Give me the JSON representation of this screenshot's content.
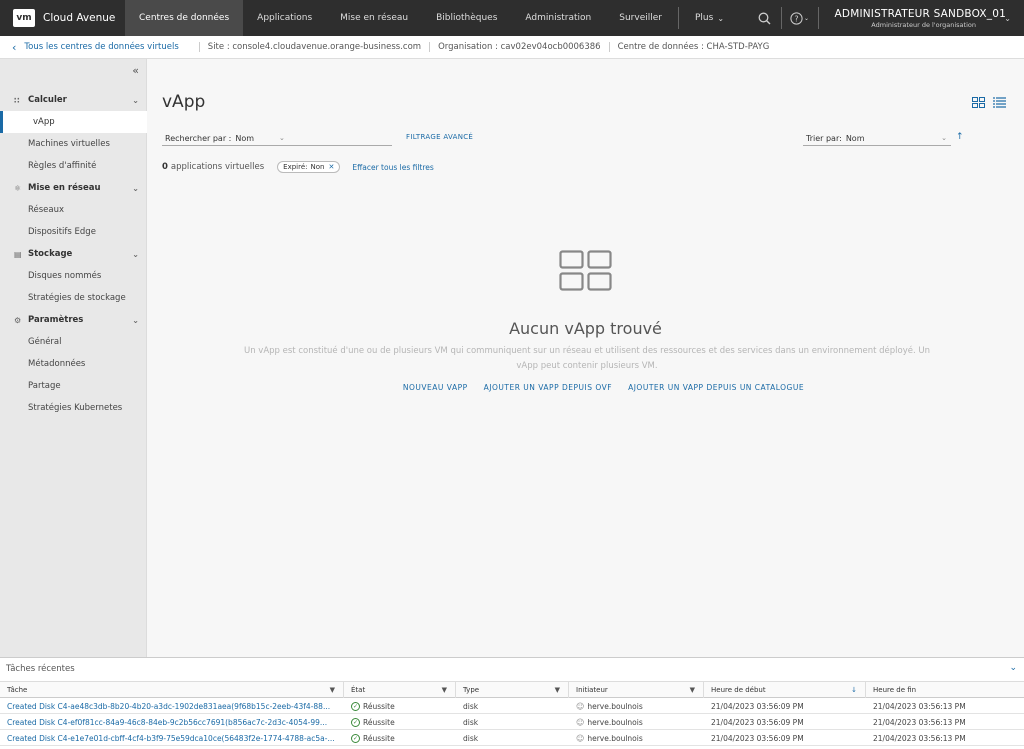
{
  "brand": {
    "logo": "vm",
    "name": "Cloud Avenue"
  },
  "topnav": {
    "items": [
      {
        "label": "Centres de données",
        "active": true
      },
      {
        "label": "Applications"
      },
      {
        "label": "Mise en réseau"
      },
      {
        "label": "Bibliothèques"
      },
      {
        "label": "Administration"
      },
      {
        "label": "Surveiller"
      }
    ],
    "more_label": "Plus",
    "user_name": "ADMINISTRATEUR SANDBOX_01",
    "user_role": "Administrateur de l'organisation"
  },
  "breadcrumb": {
    "back_label": "Tous les centres de données virtuels",
    "site": "Site : console4.cloudavenue.orange-business.com",
    "organisation": "Organisation : cav02ev04ocb0006386",
    "datacenter": "Centre de données : CHA-STD-PAYG"
  },
  "sidebar": {
    "groups": [
      {
        "label": "Calculer",
        "icon": "grid-icon",
        "items": [
          "vApp",
          "Machines virtuelles",
          "Règles d'affinité"
        ]
      },
      {
        "label": "Mise en réseau",
        "icon": "network-icon",
        "items": [
          "Réseaux",
          "Dispositifs Edge"
        ]
      },
      {
        "label": "Stockage",
        "icon": "storage-icon",
        "items": [
          "Disques nommés",
          "Stratégies de stockage"
        ]
      },
      {
        "label": "Paramètres",
        "icon": "gear-icon",
        "items": [
          "Général",
          "Métadonnées",
          "Partage",
          "Stratégies Kubernetes"
        ]
      }
    ],
    "active_item": "vApp"
  },
  "main": {
    "title": "vApp",
    "search_label": "Rechercher par :",
    "search_value": "Nom",
    "advanced_filter": "FILTRAGE AVANCÉ",
    "sort_label": "Trier par:",
    "sort_value": "Nom",
    "count": "0",
    "count_suffix": "applications virtuelles",
    "chip_label": "Expiré:",
    "chip_value": "Non",
    "clear_filters": "Effacer tous les filtres",
    "empty_title": "Aucun vApp trouvé",
    "empty_desc": "Un vApp est constitué d'une ou de plusieurs VM qui communiquent sur un réseau et utilisent des ressources et des services dans un environnement déployé. Un vApp peut contenir plusieurs VM.",
    "actions": [
      "NOUVEAU VAPP",
      "AJOUTER UN VAPP DEPUIS OVF",
      "AJOUTER UN VAPP DEPUIS UN CATALOGUE"
    ]
  },
  "tasks": {
    "title": "Tâches récentes",
    "columns": [
      "Tâche",
      "État",
      "Type",
      "Initiateur",
      "Heure de début",
      "Heure de fin"
    ],
    "rows": [
      {
        "task": "Created Disk C4-ae48c3db-8b20-4b20-a3dc-1902de831aea(9f68b15c-2eeb-43f4-88...",
        "state": "Réussite",
        "type": "disk",
        "initiator": "herve.boulnois",
        "start": "21/04/2023 03:56:09 PM",
        "end": "21/04/2023 03:56:13 PM"
      },
      {
        "task": "Created Disk C4-ef0f81cc-84a9-46c8-84eb-9c2b56cc7691(b856ac7c-2d3c-4054-99...",
        "state": "Réussite",
        "type": "disk",
        "initiator": "herve.boulnois",
        "start": "21/04/2023 03:56:09 PM",
        "end": "21/04/2023 03:56:13 PM"
      },
      {
        "task": "Created Disk C4-e1e7e01d-cbff-4cf4-b3f9-75e59dca10ce(56483f2e-1774-4788-ac5a-...",
        "state": "Réussite",
        "type": "disk",
        "initiator": "herve.boulnois",
        "start": "21/04/2023 03:56:09 PM",
        "end": "21/04/2023 03:56:13 PM"
      }
    ]
  },
  "colors": {
    "topnav_bg": "#2e2e2e",
    "link": "#1a6aa6",
    "success": "#3a8a3a",
    "sidebar_bg": "#e8e8e8"
  }
}
